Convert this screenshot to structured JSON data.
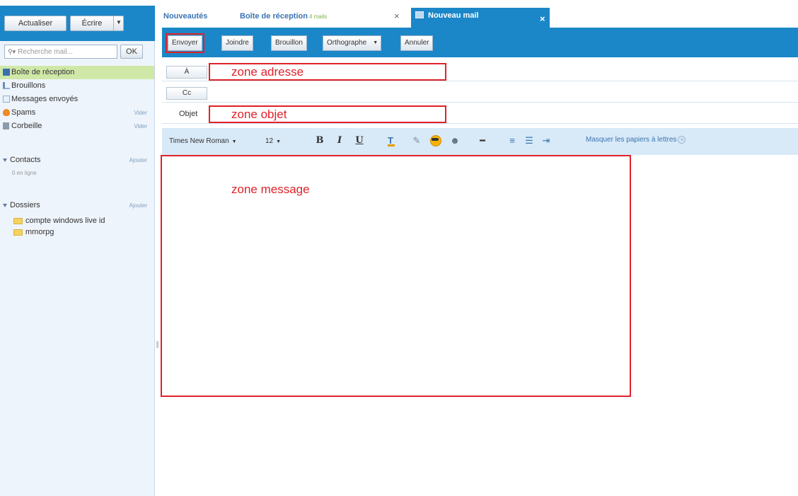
{
  "sidebar": {
    "refresh_label": "Actualiser",
    "write_label": "Écrire",
    "search_placeholder": "Recherche mail...",
    "search_ok": "OK",
    "folders": [
      {
        "label": "Boîte de réception",
        "action": ""
      },
      {
        "label": "Brouillons",
        "action": ""
      },
      {
        "label": "Messages envoyés",
        "action": ""
      },
      {
        "label": "Spams",
        "action": "Vider"
      },
      {
        "label": "Corbeille",
        "action": "Vider"
      }
    ],
    "contacts": {
      "label": "Contacts",
      "add": "Ajouter",
      "status": "0 en ligne"
    },
    "dossiers": {
      "label": "Dossiers",
      "add": "Ajouter",
      "items": [
        "compte windows live id",
        "mmorpg"
      ]
    }
  },
  "tabs": {
    "news": "Nouveautés",
    "inbox": "Boîte de réception",
    "inbox_count": "4 mails",
    "new_mail": "Nouveau mail",
    "close": "×"
  },
  "toolbar": {
    "send": "Envoyer",
    "attach": "Joindre",
    "draft": "Brouillon",
    "spell": "Orthographe",
    "cancel": "Annuler"
  },
  "compose": {
    "to_label": "À",
    "cc_label": "Cc",
    "subject_label": "Objet",
    "to_zone": "zone adresse",
    "subject_zone": "zone objet",
    "message_zone": "zone message"
  },
  "format": {
    "font": "Times New Roman",
    "size": "12",
    "bold": "B",
    "italic": "I",
    "underline": "U",
    "hide_stationery": "Masquer les papiers à lettres"
  },
  "colors": {
    "accent": "#1b87c8",
    "annotation": "#e0222a",
    "active_folder": "#cfe8a8"
  }
}
